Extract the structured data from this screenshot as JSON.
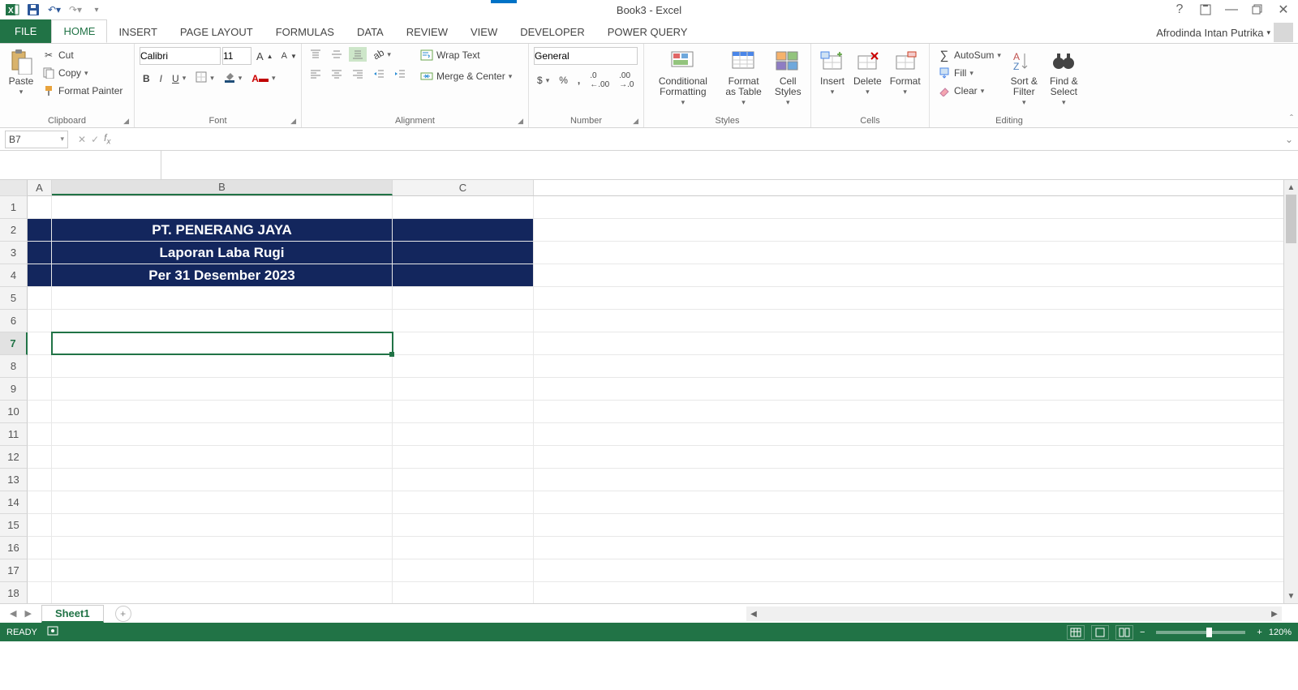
{
  "title": "Book3 - Excel",
  "user": "Afrodinda Intan Putrika",
  "tabs": {
    "file": "FILE",
    "home": "HOME",
    "insert": "INSERT",
    "page_layout": "PAGE LAYOUT",
    "formulas": "FORMULAS",
    "data": "DATA",
    "review": "REVIEW",
    "view": "VIEW",
    "developer": "DEVELOPER",
    "power_query": "POWER QUERY"
  },
  "ribbon": {
    "clipboard": {
      "label": "Clipboard",
      "paste": "Paste",
      "cut": "Cut",
      "copy": "Copy",
      "format_painter": "Format Painter"
    },
    "font": {
      "label": "Font",
      "name": "Calibri",
      "size": "11"
    },
    "alignment": {
      "label": "Alignment",
      "wrap": "Wrap Text",
      "merge": "Merge & Center"
    },
    "number": {
      "label": "Number",
      "format": "General"
    },
    "styles": {
      "label": "Styles",
      "cond": "Conditional Formatting",
      "table": "Format as Table",
      "cell": "Cell Styles"
    },
    "cells": {
      "label": "Cells",
      "insert": "Insert",
      "delete": "Delete",
      "format": "Format"
    },
    "editing": {
      "label": "Editing",
      "autosum": "AutoSum",
      "fill": "Fill",
      "clear": "Clear",
      "sort": "Sort & Filter",
      "find": "Find & Select"
    }
  },
  "namebox": "B7",
  "columns": {
    "A": "A",
    "B": "B",
    "C": "C"
  },
  "rows": [
    "1",
    "2",
    "3",
    "4",
    "5",
    "6",
    "7",
    "8",
    "9",
    "10",
    "11",
    "12",
    "13",
    "14",
    "15",
    "16",
    "17",
    "18"
  ],
  "content": {
    "r2": "PT. PENERANG JAYA",
    "r3": "Laporan Laba Rugi",
    "r4": "Per 31 Desember 2023"
  },
  "sheet": {
    "name": "Sheet1"
  },
  "status": {
    "ready": "READY",
    "zoom": "120%"
  }
}
